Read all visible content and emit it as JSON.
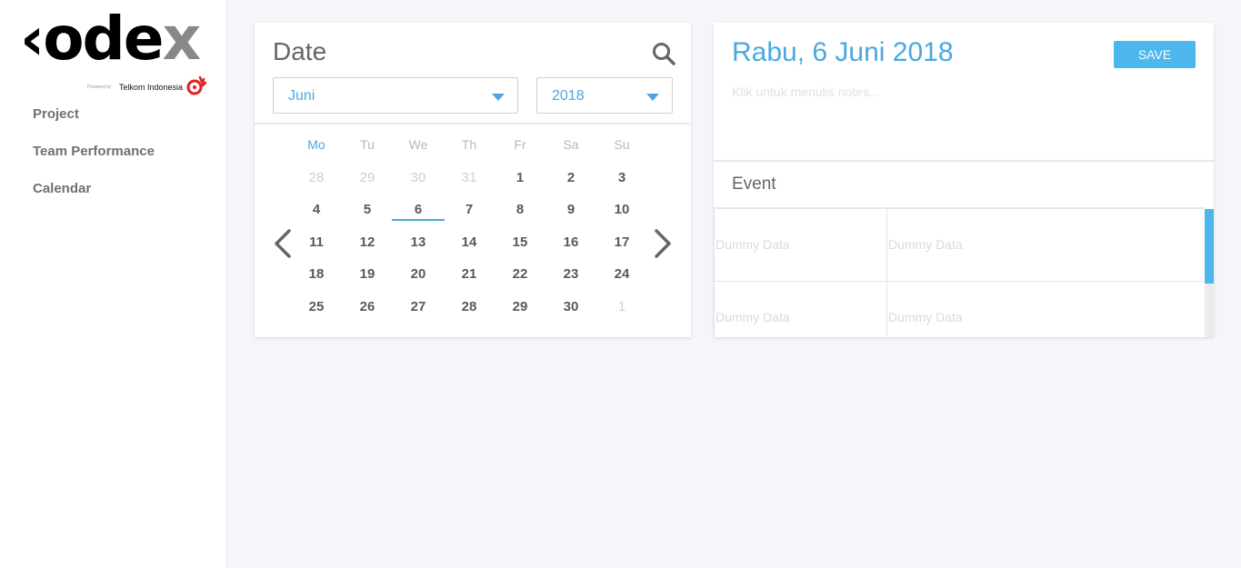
{
  "brand": {
    "logo_word_main": "‹ode",
    "logo_word_x": "x",
    "powered_by": "Powered by",
    "partner": "Telkom Indonesia",
    "accent_color": "#4aa8e0",
    "logo_mark_color": "#e02020"
  },
  "sidebar": {
    "items": [
      {
        "label": "Project"
      },
      {
        "label": "Team Performance"
      },
      {
        "label": "Calendar"
      }
    ]
  },
  "date_panel": {
    "title": "Date",
    "search_icon": "search-icon",
    "month_select": {
      "value": "Juni"
    },
    "year_select": {
      "value": "2018"
    },
    "prev_icon": "chevron-left-icon",
    "next_icon": "chevron-right-icon",
    "weekdays": [
      "Mo",
      "Tu",
      "We",
      "Th",
      "Fr",
      "Sa",
      "Su"
    ],
    "weeks": [
      [
        {
          "d": "28",
          "muted": true
        },
        {
          "d": "29",
          "muted": true
        },
        {
          "d": "30",
          "muted": true
        },
        {
          "d": "31",
          "muted": true
        },
        {
          "d": "1"
        },
        {
          "d": "2"
        },
        {
          "d": "3"
        }
      ],
      [
        {
          "d": "4"
        },
        {
          "d": "5"
        },
        {
          "d": "6",
          "selected": true
        },
        {
          "d": "7"
        },
        {
          "d": "8"
        },
        {
          "d": "9"
        },
        {
          "d": "10"
        }
      ],
      [
        {
          "d": "11"
        },
        {
          "d": "12"
        },
        {
          "d": "13"
        },
        {
          "d": "14"
        },
        {
          "d": "15"
        },
        {
          "d": "16"
        },
        {
          "d": "17"
        }
      ],
      [
        {
          "d": "18"
        },
        {
          "d": "19"
        },
        {
          "d": "20"
        },
        {
          "d": "21"
        },
        {
          "d": "22"
        },
        {
          "d": "23"
        },
        {
          "d": "24"
        }
      ],
      [
        {
          "d": "25"
        },
        {
          "d": "26"
        },
        {
          "d": "27"
        },
        {
          "d": "28"
        },
        {
          "d": "29"
        },
        {
          "d": "30"
        },
        {
          "d": "1",
          "muted": true
        }
      ]
    ]
  },
  "note_panel": {
    "date_heading": "Rabu, 6 Juni 2018",
    "save_label": "SAVE",
    "notes_placeholder": "Klik untuk menulis notes...",
    "event_title": "Event",
    "events": [
      {
        "col1": "Dummy Data",
        "col2": "Dummy Data"
      },
      {
        "col1": "Dummy Data",
        "col2": "Dummy Data"
      }
    ]
  }
}
